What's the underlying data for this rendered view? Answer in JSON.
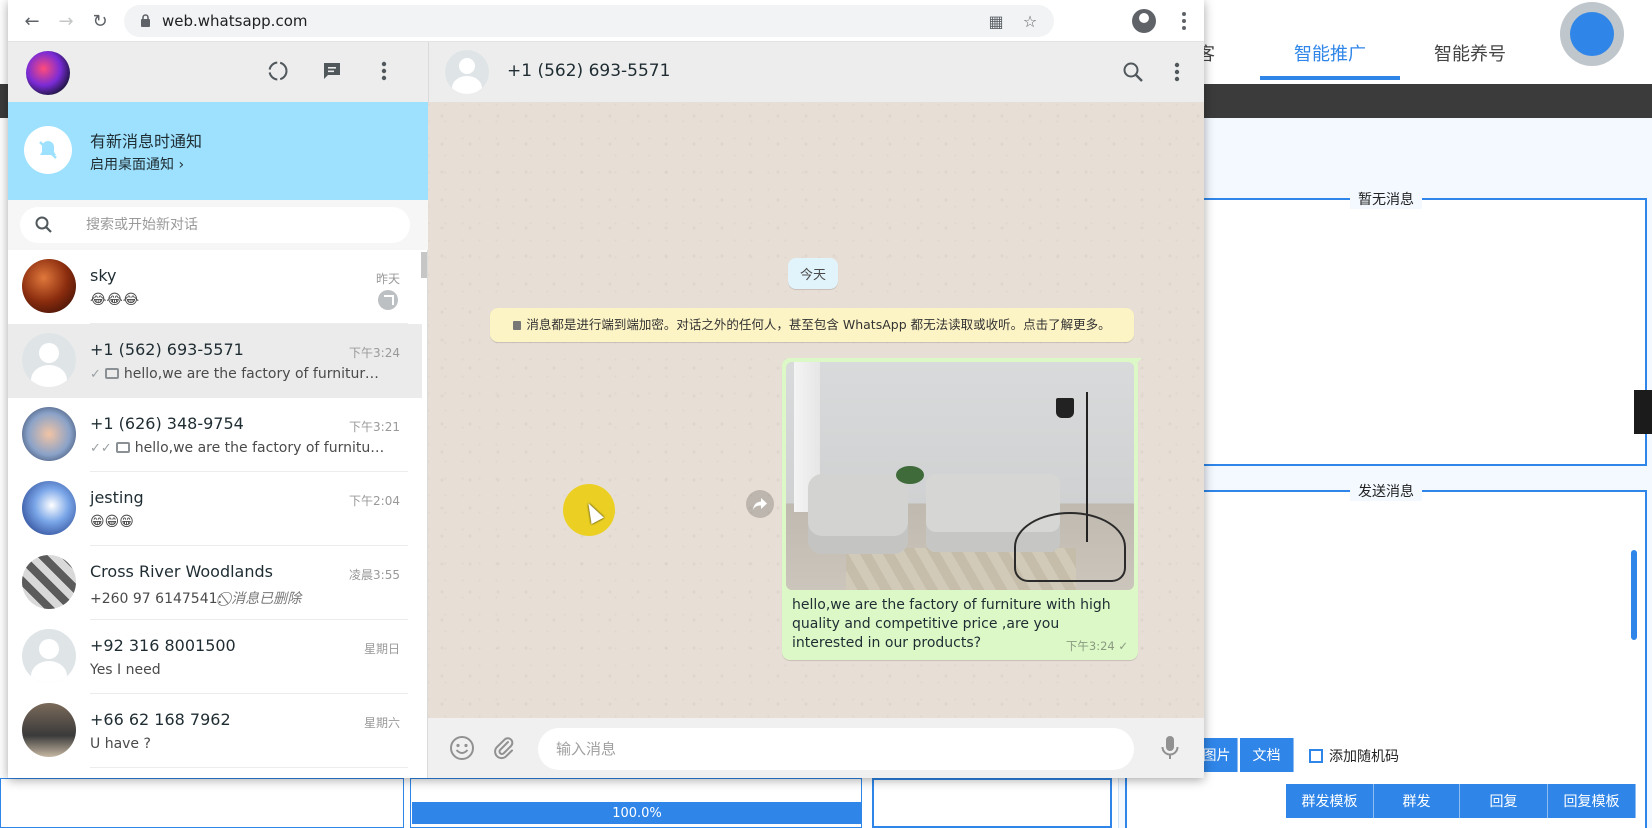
{
  "background_app": {
    "tabs": [
      "客",
      "智能推广",
      "智能养号"
    ],
    "active_tab": "智能推广",
    "group_received_title": "暂无消息",
    "group_send_title": "发送消息",
    "buttons_row1": [
      "图片",
      "文档"
    ],
    "random_code_label": "添加随机码",
    "buttons_row2": [
      "群发模板",
      "群发",
      "回复",
      "回复模板"
    ],
    "progress_text": "100.0%"
  },
  "browser": {
    "url": "web.whatsapp.com"
  },
  "whatsapp": {
    "notification": {
      "title": "有新消息时通知",
      "link": "启用桌面通知 ›"
    },
    "search_placeholder": "搜索或开始新对话",
    "chats": [
      {
        "name": "sky",
        "time": "昨天",
        "preview": "😂😂😂",
        "ticks": "",
        "photo": false,
        "avatar": "mars",
        "pinned": true
      },
      {
        "name": "+1 (562) 693-5571",
        "time": "下午3:24",
        "preview": "hello,we are the factory of furniture wi...",
        "ticks": "✓",
        "photo": true,
        "avatar": "default",
        "pinned": false
      },
      {
        "name": "+1 (626) 348-9754",
        "time": "下午3:21",
        "preview": "hello,we are the factory of furniture w...",
        "ticks": "✓✓",
        "photo": true,
        "avatar": "baby",
        "pinned": false
      },
      {
        "name": "jesting",
        "time": "下午2:04",
        "preview": "😁😁😁",
        "ticks": "",
        "photo": false,
        "avatar": "snow",
        "pinned": false
      },
      {
        "name": "Cross River Woodlands",
        "time": "凌晨3:55",
        "preview_sender": "+260 97 6147541: ",
        "preview": "⃠ 消息已删除",
        "ticks": "",
        "photo": false,
        "avatar": "wood",
        "pinned": false,
        "deleted": true
      },
      {
        "name": "+92 316 8001500",
        "time": "星期日",
        "preview": "Yes I need",
        "ticks": "",
        "photo": false,
        "avatar": "default",
        "pinned": false
      },
      {
        "name": "+66 62 168 7962",
        "time": "星期六",
        "preview": "U have ?",
        "ticks": "",
        "photo": false,
        "avatar": "people",
        "pinned": false
      }
    ],
    "conversation": {
      "contact": "+1 (562) 693-5571",
      "date_chip": "今天",
      "encryption_notice": "消息都是进行端到端加密。对话之外的任何人，甚至包含 WhatsApp 都无法读取或收听。点击了解更多。",
      "outgoing_caption": "hello,we are the factory of furniture with high quality and competitive price ,are you interested in our products?",
      "outgoing_time": "下午3:24",
      "outgoing_status": "✓",
      "input_placeholder": "输入消息"
    }
  }
}
